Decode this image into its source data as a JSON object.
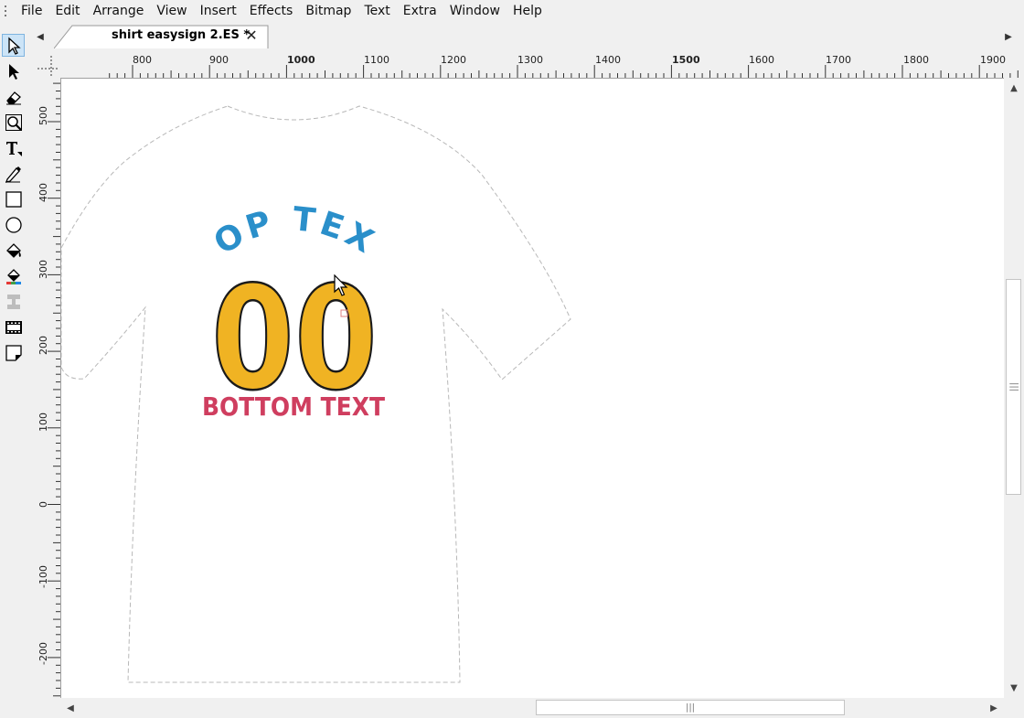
{
  "menu": [
    "File",
    "Edit",
    "Arrange",
    "View",
    "Insert",
    "Effects",
    "Bitmap",
    "Text",
    "Extra",
    "Window",
    "Help"
  ],
  "tools": [
    {
      "name": "select-tool",
      "icon": "arrow-outline-icon",
      "active": true
    },
    {
      "name": "node-edit-tool",
      "icon": "arrow-filled-icon",
      "active": false
    },
    {
      "name": "eraser-tool",
      "icon": "eraser-icon",
      "active": false
    },
    {
      "name": "zoom-tool",
      "icon": "magnifier-icon",
      "active": false
    },
    {
      "name": "text-tool",
      "icon": "text-t-icon",
      "active": false
    },
    {
      "name": "freehand-tool",
      "icon": "pen-icon",
      "active": false
    },
    {
      "name": "rectangle-tool",
      "icon": "rectangle-icon",
      "active": false
    },
    {
      "name": "ellipse-tool",
      "icon": "circle-icon",
      "active": false
    },
    {
      "name": "fill-tool",
      "icon": "paint-bucket-icon",
      "active": false
    },
    {
      "name": "color-fill-tool",
      "icon": "color-bucket-icon",
      "active": false
    },
    {
      "name": "stamp-tool",
      "icon": "stamp-icon",
      "active": false
    },
    {
      "name": "weed-lines-tool",
      "icon": "film-strip-icon",
      "active": false
    },
    {
      "name": "page-tool",
      "icon": "page-curl-icon",
      "active": false
    }
  ],
  "tab": {
    "title": "shirt easysign 2.ES *",
    "close_label": "✕",
    "prev": "◀",
    "next": "▶"
  },
  "ruler": {
    "horizontal": [
      "800",
      "900",
      "1000",
      "1100",
      "1200",
      "1300",
      "1400",
      "1500",
      "1600",
      "1700",
      "1800",
      "1900"
    ],
    "vertical": [
      "500",
      "400",
      "300",
      "200",
      "100",
      "0",
      "-100",
      "-200"
    ]
  },
  "artwork": {
    "top_text": "TOP TEXT",
    "number": "00",
    "bottom_text": "BOTTOM TEXT",
    "colors": {
      "top_text": "#2a8fca",
      "number_fill": "#f0b323",
      "number_outline": "#1a1a1a",
      "bottom_text": "#cf3e5f",
      "shirt_outline": "#b8b8b8"
    }
  },
  "scroll": {
    "up": "▲",
    "down": "▼",
    "left": "◀",
    "right": "▶",
    "grip": "|||"
  }
}
